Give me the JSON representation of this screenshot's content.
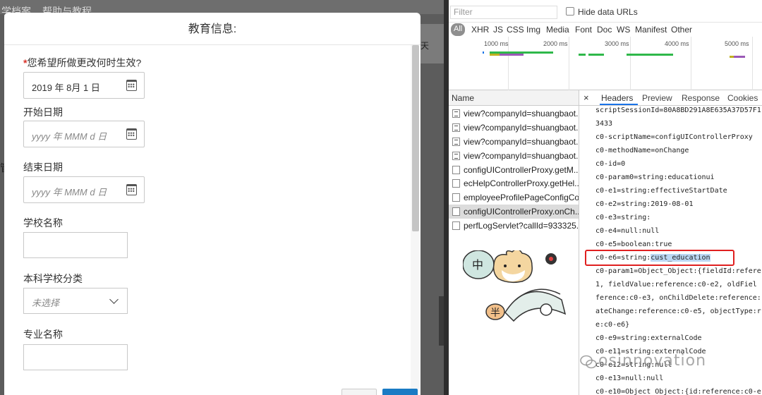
{
  "app": {
    "nav_items": [
      "学档案",
      "帮助与教程"
    ],
    "left_edge_text": "管",
    "strip_text": "天"
  },
  "modal": {
    "title": "教育信息:",
    "fields": {
      "effective_label": "您希望所做更改何时生效?",
      "effective_value": "2019 年 8月 1 日",
      "start_label": "开始日期",
      "start_placeholder": "yyyy 年 MMM d 日",
      "end_label": "结束日期",
      "end_placeholder": "yyyy 年 MMM d 日",
      "school_label": "学校名称",
      "category_label": "本科学校分类",
      "category_placeholder": "未选择",
      "major_label": "专业名称"
    }
  },
  "devtools": {
    "filter_placeholder": "Filter",
    "hide_data_urls": "Hide data URLs",
    "types": [
      "All",
      "XHR",
      "JS",
      "CSS",
      "Img",
      "Media",
      "Font",
      "Doc",
      "WS",
      "Manifest",
      "Other"
    ],
    "timeline_ticks": [
      "1000 ms",
      "2000 ms",
      "3000 ms",
      "4000 ms",
      "5000 ms"
    ],
    "name_header": "Name",
    "requests": [
      {
        "name": "view?companyId=shuangbaot...",
        "icon": "image-icon"
      },
      {
        "name": "view?companyId=shuangbaot...",
        "icon": "image-icon"
      },
      {
        "name": "view?companyId=shuangbaot...",
        "icon": "image-icon"
      },
      {
        "name": "view?companyId=shuangbaot...",
        "icon": "image-icon"
      },
      {
        "name": "configUIControllerProxy.getM...",
        "icon": "doc-icon"
      },
      {
        "name": "ecHelpControllerProxy.getHel...",
        "icon": "doc-icon"
      },
      {
        "name": "employeeProfilePageConfigCo...",
        "icon": "doc-icon"
      },
      {
        "name": "configUIControllerProxy.onCh...",
        "icon": "doc-icon",
        "selected": true
      },
      {
        "name": "perfLogServlet?callId=933325...",
        "icon": "doc-icon"
      }
    ],
    "close_symbol": "×",
    "detail_tabs": [
      "Headers",
      "Preview",
      "Response",
      "Cookies"
    ],
    "payload_lines": [
      "scriptSessionId=80A8BD291A8E635A37D57F1",
      "3433",
      "c0-scriptName=configUIControllerProxy",
      "c0-methodName=onChange",
      "c0-id=0",
      "c0-param0=string:educationui",
      "c0-e1=string:effectiveStartDate",
      "c0-e2=string:2019-08-01",
      "c0-e3=string:",
      "c0-e4=null:null",
      "c0-e5=boolean:true",
      "c0-e6=string:",
      "c0-param1=Object_Object:{fieldId:refere",
      "1, fieldValue:reference:c0-e2, oldFiel",
      "ference:c0-e3, onChildDelete:reference:",
      "ateChange:reference:c0-e5, objectType:r",
      "e:c0-e6}",
      "c0-e9=string:externalCode",
      "c0-e11=string:externalCode",
      "c0-e12=string:null",
      "c0-e13=null:null",
      "c0-e10=Object_Object:{id:reference:c0-e"
    ],
    "highlighted_value": "cust_education",
    "sticker_chars": [
      "中",
      "半"
    ],
    "watermark": "osinnovation"
  }
}
